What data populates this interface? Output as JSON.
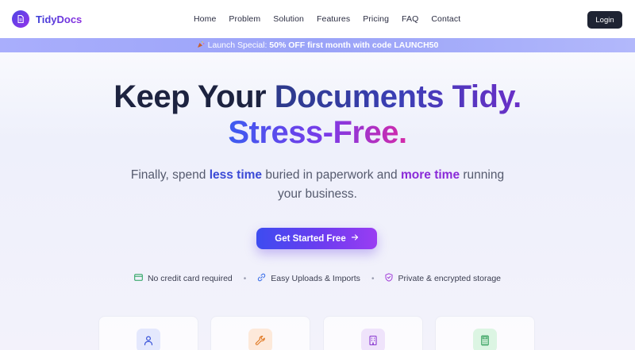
{
  "header": {
    "brand": "TidyDocs",
    "nav": [
      "Home",
      "Problem",
      "Solution",
      "Features",
      "Pricing",
      "FAQ",
      "Contact"
    ],
    "login_label": "Login"
  },
  "promo": {
    "icon": "party-popper-icon",
    "prefix": "Launch Special:",
    "offer": "50% OFF first month",
    "middle": "with",
    "code_text": "code LAUNCH50"
  },
  "hero": {
    "line1_a": "Keep Your",
    "line1_b": "Documents Tidy.",
    "line2": "Stress-Free.",
    "subtitle_1": "Finally, spend",
    "subtitle_hl1": "less time",
    "subtitle_2": "buried in paperwork and",
    "subtitle_hl2": "more time",
    "subtitle_3": "running your business.",
    "cta_label": "Get Started Free"
  },
  "features": [
    {
      "label": "No credit card required",
      "icon": "credit-card-icon",
      "color": "#22a05a"
    },
    {
      "label": "Easy Uploads & Imports",
      "icon": "link-icon",
      "color": "#3b6ee8"
    },
    {
      "label": "Private & encrypted storage",
      "icon": "shield-icon",
      "color": "#a03ad8"
    }
  ],
  "cards": [
    {
      "icon": "user-icon",
      "bg": "#e4e8fd",
      "color": "#3b55d9"
    },
    {
      "icon": "wrench-icon",
      "bg": "#fde9da",
      "color": "#e07a25"
    },
    {
      "icon": "building-icon",
      "bg": "#efe3fb",
      "color": "#8a3ad0"
    },
    {
      "icon": "calculator-icon",
      "bg": "#dcf5e3",
      "color": "#2a9b55"
    }
  ],
  "colors": {
    "brand": "#4f46e5",
    "accent_purple": "#9333ea",
    "login_bg": "#1f2433"
  }
}
